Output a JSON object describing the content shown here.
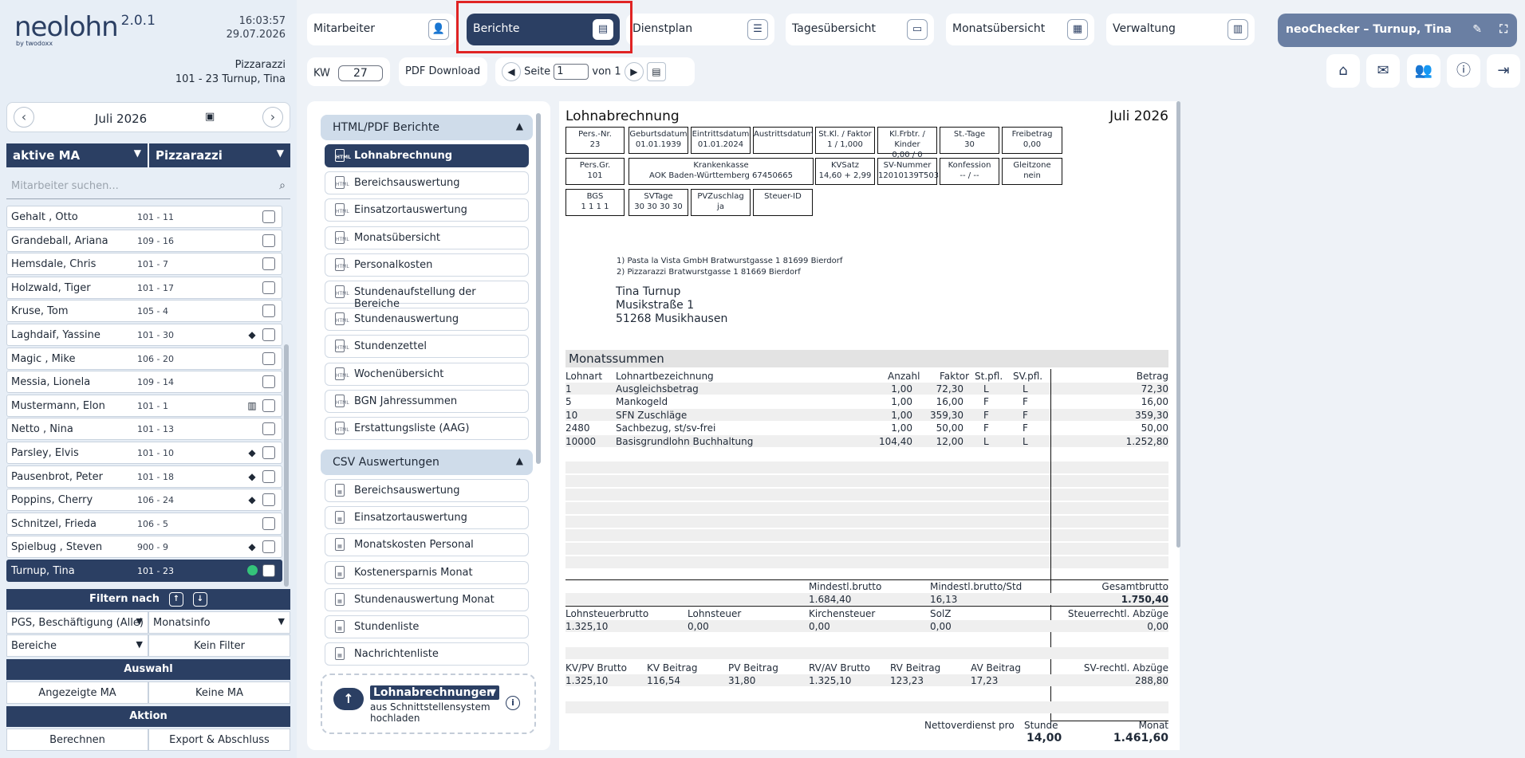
{
  "app": {
    "logo": "neolohn",
    "version": "2.0.1",
    "logo_sub": "by twodoxx",
    "time": "16:03:57",
    "date": "29.07.2026",
    "company": "Pizzarazzi",
    "employee_line": "101 - 23 Turnup, Tina"
  },
  "calendar": {
    "month": "Juli 2026",
    "prev": "‹",
    "next": "›"
  },
  "filters": {
    "status": "aktive MA",
    "site": "Pizzarazzi",
    "search_placeholder": "Mitarbeiter suchen..."
  },
  "employees": [
    {
      "name": "Gehalt , Otto",
      "nr": "101 - 11",
      "flag": ""
    },
    {
      "name": "Grandeball, Ariana",
      "nr": "109 - 16",
      "flag": ""
    },
    {
      "name": "Hemsdale, Chris",
      "nr": "101 - 7",
      "flag": ""
    },
    {
      "name": "Holzwald, Tiger",
      "nr": "101 - 17",
      "flag": ""
    },
    {
      "name": "Kruse, Tom",
      "nr": "105 - 4",
      "flag": ""
    },
    {
      "name": "Laghdaif, Yassine",
      "nr": "101 - 30",
      "flag": "warn"
    },
    {
      "name": "Magic , Mike",
      "nr": "106 - 20",
      "flag": ""
    },
    {
      "name": "Messia, Lionela",
      "nr": "109 - 14",
      "flag": ""
    },
    {
      "name": "Mustermann, Elon",
      "nr": "101 - 1",
      "flag": "cake"
    },
    {
      "name": "Netto , Nina",
      "nr": "101 - 13",
      "flag": ""
    },
    {
      "name": "Parsley, Elvis",
      "nr": "101 - 10",
      "flag": "warn"
    },
    {
      "name": "Pausenbrot, Peter",
      "nr": "101 - 18",
      "flag": "warn"
    },
    {
      "name": "Poppins, Cherry",
      "nr": "106 - 24",
      "flag": "warn"
    },
    {
      "name": "Schnitzel, Frieda",
      "nr": "106 - 5",
      "flag": ""
    },
    {
      "name": "Spielbug , Steven",
      "nr": "900 - 9",
      "flag": "warn"
    },
    {
      "name": "Turnup, Tina",
      "nr": "101 - 23",
      "flag": "dot",
      "active": true
    }
  ],
  "panel": {
    "filter_title": "Filtern nach",
    "pgs": "PGS, Beschäftigung (Alle)",
    "monatsinfo": "Monatsinfo",
    "bereiche": "Bereiche",
    "kein_filter": "Kein Filter",
    "auswahl_title": "Auswahl",
    "angezeigte": "Angezeigte MA",
    "keine": "Keine MA",
    "aktion_title": "Aktion",
    "berechnen": "Berechnen",
    "export": "Export & Abschluss"
  },
  "topnav": [
    "Mitarbeiter",
    "Berichte",
    "Dienstplan",
    "Tagesübersicht",
    "Monatsübersicht",
    "Verwaltung"
  ],
  "checker": "neoChecker – Turnup, Tina",
  "toolbar": {
    "kw_label": "KW",
    "kw_value": "27",
    "pdf": "PDF Download",
    "seite": "Seite",
    "page": "1",
    "von": "von 1"
  },
  "menu": {
    "html_group": "HTML/PDF Berichte",
    "html_items": [
      "Lohnabrechnung",
      "Bereichsauswertung",
      "Einsatzortauswertung",
      "Monatsübersicht",
      "Personalkosten",
      "Stundenaufstellung der Bereiche",
      "Stundenauswertung",
      "Stundenzettel",
      "Wochenübersicht",
      "BGN Jahressummen",
      "Erstattungsliste (AAG)"
    ],
    "csv_group": "CSV Auswertungen",
    "csv_items": [
      "Bereichsauswertung",
      "Einsatzortauswertung",
      "Monatskosten Personal",
      "Kostenersparnis Monat",
      "Stundenauswertung Monat",
      "Stundenliste",
      "Nachrichtenliste"
    ],
    "upload_select": "Lohnabrechnungen",
    "upload_text1": "aus Schnittstellensystem",
    "upload_text2": "hochladen"
  },
  "payslip": {
    "title": "Lohnabrechnung",
    "month": "Juli 2026",
    "boxes": [
      {
        "l": "Pers.-Nr.",
        "v": "23"
      },
      {
        "l": "Geburtsdatum",
        "v": "01.01.1939"
      },
      {
        "l": "Eintrittsdatum",
        "v": "01.01.2024"
      },
      {
        "l": "Austrittsdatum",
        "v": ""
      },
      {
        "l": "St.Kl. / Faktor",
        "v": "1 / 1,000"
      },
      {
        "l": "Kl.Frbtr. / Kinder",
        "v": "0,00 / 0"
      },
      {
        "l": "St.-Tage",
        "v": "30"
      },
      {
        "l": "Freibetrag",
        "v": "0,00"
      },
      {
        "l": "Pers.Gr.",
        "v": "101"
      },
      {
        "l": "Krankenkasse",
        "v": "AOK Baden-Württemberg 67450665"
      },
      {
        "l": "KVSatz",
        "v": "14,60 + 2,99"
      },
      {
        "l": "SV-Nummer",
        "v": "12010139T503"
      },
      {
        "l": "Konfession",
        "v": "-- / --"
      },
      {
        "l": "Gleitzone",
        "v": "nein"
      },
      {
        "l": "BGS",
        "v": "1  1  1  1"
      },
      {
        "l": "SVTage",
        "v": "30 30 30 30"
      },
      {
        "l": "PVZuschlag",
        "v": "ja"
      },
      {
        "l": "Steuer-ID",
        "v": ""
      }
    ],
    "addr1": "1) Pasta la Vista GmbH Bratwurstgasse 1 81699 Bierdorf",
    "addr2": "2) Pizzarazzi Bratwurstgasse 1 81669 Bierdorf",
    "name": "Tina Turnup",
    "street": "Musikstraße 1",
    "city": "51268 Musikhausen",
    "section": "Monatssummen",
    "cols": {
      "lohnart": "Lohnart",
      "bez": "Lohnartbezeichnung",
      "anzahl": "Anzahl",
      "faktor": "Faktor",
      "st": "St.pfl.",
      "sv": "SV.pfl.",
      "betrag": "Betrag"
    },
    "rows": [
      {
        "la": "1",
        "bez": "Ausgleichsbetrag",
        "anz": "1,00",
        "fak": "72,30",
        "st": "L",
        "sv": "L",
        "bet": "72,30"
      },
      {
        "la": "5",
        "bez": "Mankogeld",
        "anz": "1,00",
        "fak": "16,00",
        "st": "F",
        "sv": "F",
        "bet": "16,00"
      },
      {
        "la": "10",
        "bez": "SFN Zuschläge",
        "anz": "1,00",
        "fak": "359,30",
        "st": "F",
        "sv": "F",
        "bet": "359,30"
      },
      {
        "la": "2480",
        "bez": "Sachbezug, st/sv-frei",
        "anz": "1,00",
        "fak": "50,00",
        "st": "F",
        "sv": "F",
        "bet": "50,00"
      },
      {
        "la": "10000",
        "bez": "Basisgrundlohn Buchhaltung",
        "anz": "104,40",
        "fak": "12,00",
        "st": "L",
        "sv": "L",
        "bet": "1.252,80"
      }
    ],
    "sum1": {
      "l_mb": "Mindestl.brutto",
      "l_mbs": "Mindestl.brutto/Std",
      "l_gb": "Gesamtbrutto",
      "mb": "1.684,40",
      "mbs": "16,13",
      "gb": "1.750,40"
    },
    "sum2": {
      "l1": "Lohnsteuerbrutto",
      "l2": "Lohnsteuer",
      "l3": "Kirchensteuer",
      "l4": "SolZ",
      "l5": "Steuerrechtl. Abzüge",
      "v1": "1.325,10",
      "v2": "0,00",
      "v3": "0,00",
      "v4": "0,00",
      "v5": "0,00"
    },
    "sum3": {
      "l1": "KV/PV Brutto",
      "l2": "KV Beitrag",
      "l3": "PV Beitrag",
      "l4": "RV/AV Brutto",
      "l5": "RV Beitrag",
      "l6": "AV Beitrag",
      "l7": "SV-rechtl. Abzüge",
      "v1": "1.325,10",
      "v2": "116,54",
      "v3": "31,80",
      "v4": "1.325,10",
      "v5": "123,23",
      "v6": "17,23",
      "v7": "288,80"
    },
    "net": {
      "label": "Nettoverdienst pro",
      "stunde": "Stunde",
      "monat": "Monat",
      "v_stunde": "14,00",
      "v_monat": "1.461,60"
    }
  }
}
